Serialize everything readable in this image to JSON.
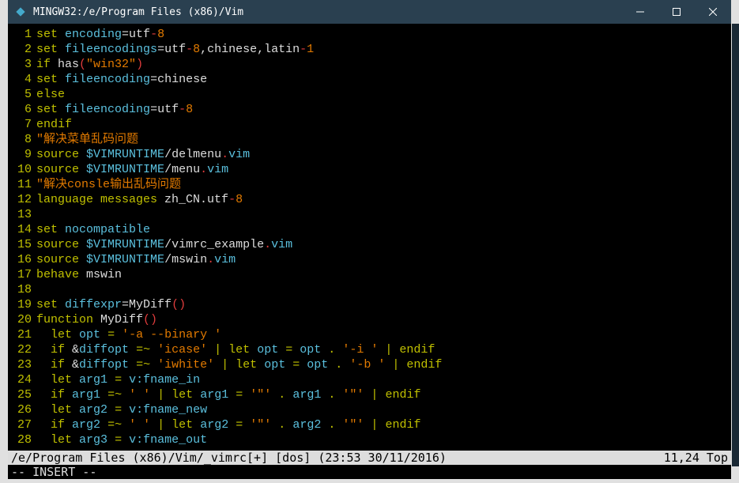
{
  "titlebar": {
    "title": "MINGW32:/e/Program Files (x86)/Vim"
  },
  "lines": [
    {
      "n": "1",
      "html": "<span class='kw'>set</span> <span class='opt'>encoding</span>=utf<span class='red'>-</span><span class='num'>8</span>"
    },
    {
      "n": "2",
      "html": "<span class='kw'>set</span> <span class='opt'>fileencodings</span>=utf<span class='red'>-</span><span class='num'>8</span>,chinese,latin<span class='red'>-</span><span class='num'>1</span>"
    },
    {
      "n": "3",
      "html": "<span class='kw'>if</span> has<span class='red'>(</span><span class='str'>\"win32\"</span><span class='red'>)</span>"
    },
    {
      "n": "4",
      "html": "<span class='kw'>set</span> <span class='opt'>fileencoding</span>=chinese"
    },
    {
      "n": "5",
      "html": "<span class='kw'>else</span>"
    },
    {
      "n": "6",
      "html": "<span class='kw'>set</span> <span class='opt'>fileencoding</span>=utf<span class='red'>-</span><span class='num'>8</span>"
    },
    {
      "n": "7",
      "html": "<span class='kw'>endif</span>"
    },
    {
      "n": "8",
      "html": "<span class='str'>\"解决菜单乱码问题</span>"
    },
    {
      "n": "9",
      "html": "<span class='kw'>source</span> <span class='var'>$VIMRUNTIME</span>/delmenu<span class='red'>.</span><span class='opt'>vim</span>"
    },
    {
      "n": "10",
      "html": "<span class='kw'>source</span> <span class='var'>$VIMRUNTIME</span>/menu<span class='red'>.</span><span class='opt'>vim</span>"
    },
    {
      "n": "11",
      "html": "<span class='str'>\"解决consle输出乱码问题</span>"
    },
    {
      "n": "12",
      "html": "<span class='kw'>language</span> <span class='kw'>messages</span> zh_CN.utf<span class='red'>-</span><span class='num'>8</span>"
    },
    {
      "n": "13",
      "html": ""
    },
    {
      "n": "14",
      "html": "<span class='kw'>set</span> <span class='opt'>nocompatible</span>"
    },
    {
      "n": "15",
      "html": "<span class='kw'>source</span> <span class='var'>$VIMRUNTIME</span>/vimrc_example<span class='red'>.</span><span class='opt'>vim</span>"
    },
    {
      "n": "16",
      "html": "<span class='kw'>source</span> <span class='var'>$VIMRUNTIME</span>/mswin<span class='red'>.</span><span class='opt'>vim</span>"
    },
    {
      "n": "17",
      "html": "<span class='kw'>behave</span> mswin"
    },
    {
      "n": "18",
      "html": ""
    },
    {
      "n": "19",
      "html": "<span class='kw'>set</span> <span class='opt'>diffexpr</span>=MyDiff<span class='red'>()</span>"
    },
    {
      "n": "20",
      "html": "<span class='kw'>function</span> MyDiff<span class='red'>()</span>"
    },
    {
      "n": "21",
      "html": "  <span class='kw'>let</span> <span class='func'>opt</span> <span class='kw'>=</span> <span class='str'>'-a --binary '</span>"
    },
    {
      "n": "22",
      "html": "  <span class='kw'>if</span> &amp;<span class='opt'>diffopt</span> <span class='kw'>=~</span> <span class='str'>'icase'</span> <span class='kw'>|</span> <span class='kw'>let</span> <span class='func'>opt</span> <span class='kw'>=</span> <span class='func'>opt</span> <span class='kw'>.</span> <span class='str'>'-i '</span> <span class='kw'>|</span> <span class='kw'>endif</span>"
    },
    {
      "n": "23",
      "html": "  <span class='kw'>if</span> &amp;<span class='opt'>diffopt</span> <span class='kw'>=~</span> <span class='str'>'iwhite'</span> <span class='kw'>|</span> <span class='kw'>let</span> <span class='func'>opt</span> <span class='kw'>=</span> <span class='func'>opt</span> <span class='kw'>.</span> <span class='str'>'-b '</span> <span class='kw'>|</span> <span class='kw'>endif</span>"
    },
    {
      "n": "24",
      "html": "  <span class='kw'>let</span> <span class='func'>arg1</span> <span class='kw'>=</span> <span class='func'>v:fname_in</span>"
    },
    {
      "n": "25",
      "html": "  <span class='kw'>if</span> <span class='func'>arg1</span> <span class='kw'>=~</span> <span class='str'>' '</span> <span class='kw'>|</span> <span class='kw'>let</span> <span class='func'>arg1</span> <span class='kw'>=</span> <span class='str'>'\"'</span> <span class='kw'>.</span> <span class='func'>arg1</span> <span class='kw'>.</span> <span class='str'>'\"'</span> <span class='kw'>|</span> <span class='kw'>endif</span>"
    },
    {
      "n": "26",
      "html": "  <span class='kw'>let</span> <span class='func'>arg2</span> <span class='kw'>=</span> <span class='func'>v:fname_new</span>"
    },
    {
      "n": "27",
      "html": "  <span class='kw'>if</span> <span class='func'>arg2</span> <span class='kw'>=~</span> <span class='str'>' '</span> <span class='kw'>|</span> <span class='kw'>let</span> <span class='func'>arg2</span> <span class='kw'>=</span> <span class='str'>'\"'</span> <span class='kw'>.</span> <span class='func'>arg2</span> <span class='kw'>.</span> <span class='str'>'\"'</span> <span class='kw'>|</span> <span class='kw'>endif</span>"
    },
    {
      "n": "28",
      "html": "  <span class='kw'>let</span> <span class='func'>arg3</span> <span class='kw'>=</span> <span class='func'>v:fname_out</span>"
    }
  ],
  "status": {
    "left": "/e/Program Files (x86)/Vim/_vimrc[+] [dos] (23:53 30/11/2016)",
    "right": "11,24 Top"
  },
  "insert": "-- INSERT --"
}
